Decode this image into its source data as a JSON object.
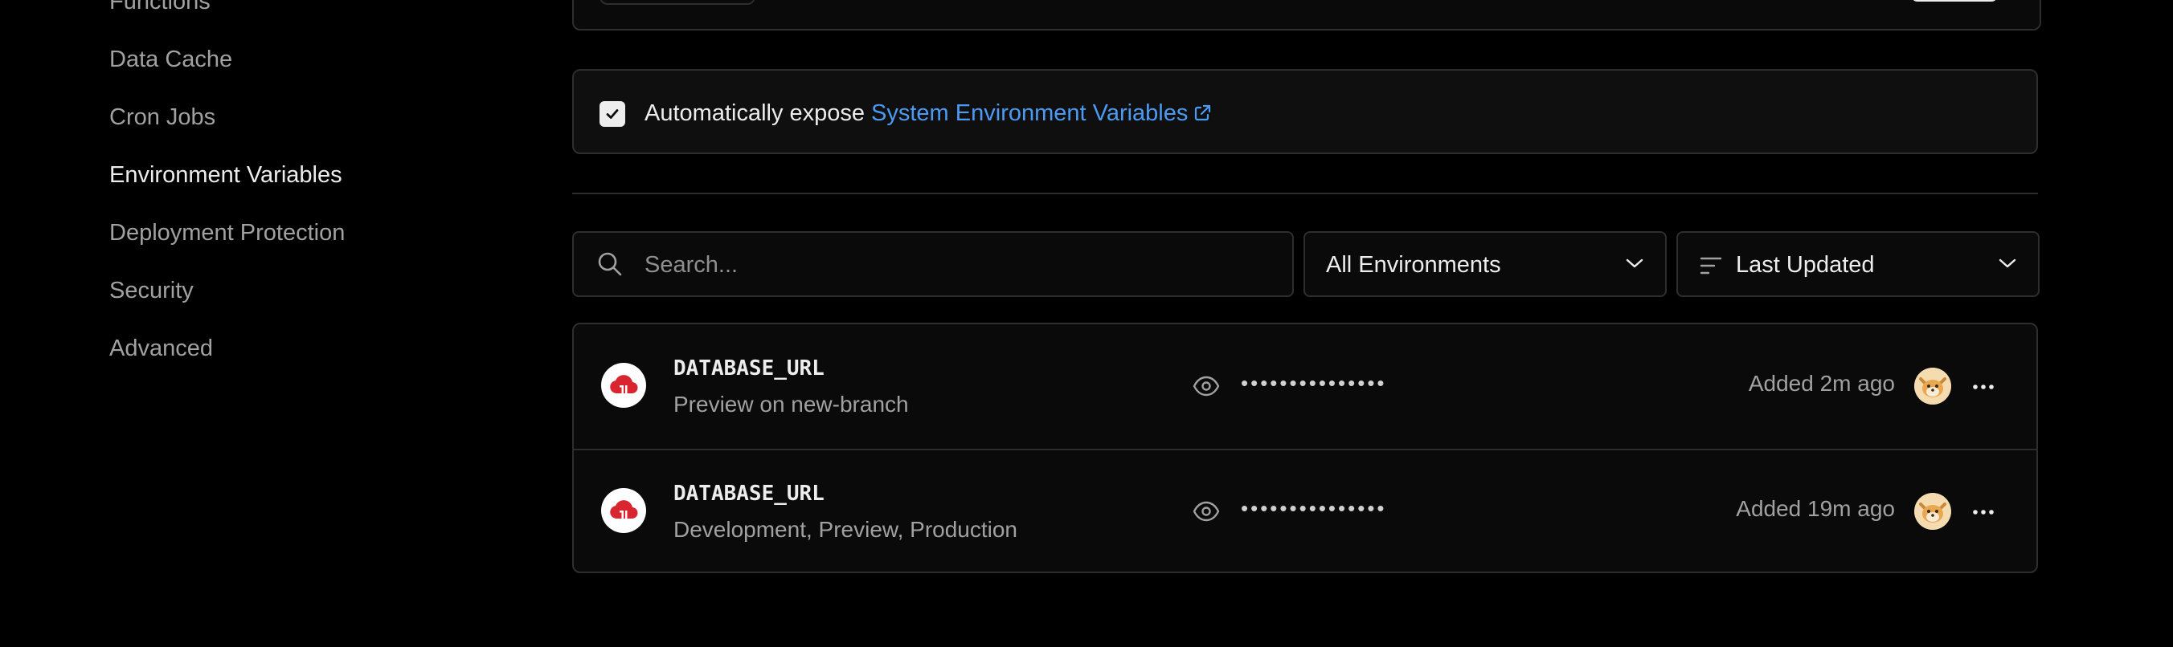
{
  "sidebar": {
    "items": [
      {
        "label": "Functions",
        "active": false
      },
      {
        "label": "Data Cache",
        "active": false
      },
      {
        "label": "Cron Jobs",
        "active": false
      },
      {
        "label": "Environment Variables",
        "active": true
      },
      {
        "label": "Deployment Protection",
        "active": false
      },
      {
        "label": "Security",
        "active": false
      },
      {
        "label": "Advanced",
        "active": false
      }
    ]
  },
  "expose": {
    "checked": true,
    "text": "Automatically expose",
    "link_text": "System Environment Variables",
    "link_icon": "external-link-icon"
  },
  "filters": {
    "search": {
      "placeholder": "Search...",
      "value": "",
      "icon": "search-icon"
    },
    "environment": {
      "selected": "All Environments",
      "icon": "chevron-down-icon"
    },
    "sort": {
      "selected": "Last Updated",
      "icon": "sort-icon"
    }
  },
  "variables": [
    {
      "name": "DATABASE_URL",
      "environments": "Preview on new-branch",
      "masked_value": "•••••••••••••••",
      "added": "Added 2m ago",
      "integration_icon": "cloud-database-icon",
      "avatar": "user-avatar"
    },
    {
      "name": "DATABASE_URL",
      "environments": "Development, Preview, Production",
      "masked_value": "•••••••••••••••",
      "added": "Added 19m ago",
      "integration_icon": "cloud-database-icon",
      "avatar": "user-avatar"
    }
  ],
  "colors": {
    "background": "#000000",
    "card": "#0f0f0f",
    "border": "#2e2e2e",
    "link": "#4b9bf5",
    "integration_red": "#d9252f",
    "text_primary": "#ededed",
    "text_secondary": "#a1a1a1"
  }
}
